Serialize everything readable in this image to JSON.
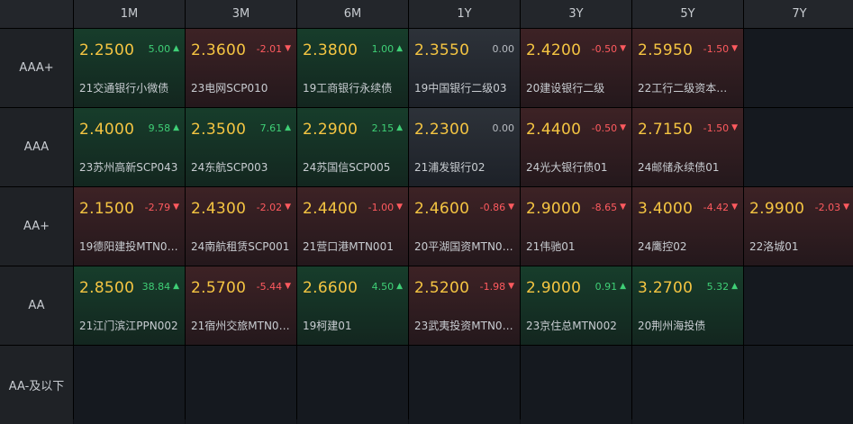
{
  "columns": [
    "1M",
    "3M",
    "6M",
    "1Y",
    "3Y",
    "5Y",
    "7Y"
  ],
  "rows": [
    {
      "label": "AAA+",
      "cells": [
        {
          "yield": "2.2500",
          "change": "5.00",
          "dir": "up",
          "name": "21交通银行小微债"
        },
        {
          "yield": "2.3600",
          "change": "-2.01",
          "dir": "down",
          "name": "23电网SCP010"
        },
        {
          "yield": "2.3800",
          "change": "1.00",
          "dir": "up",
          "name": "19工商银行永续债"
        },
        {
          "yield": "2.3550",
          "change": "0.00",
          "dir": "flat",
          "name": "19中国银行二级03"
        },
        {
          "yield": "2.4200",
          "change": "-0.50",
          "dir": "down",
          "name": "20建设银行二级"
        },
        {
          "yield": "2.5950",
          "change": "-1.50",
          "dir": "down",
          "name": "22工行二级资本债…"
        },
        null
      ]
    },
    {
      "label": "AAA",
      "cells": [
        {
          "yield": "2.4000",
          "change": "9.58",
          "dir": "up",
          "name": "23苏州高新SCP043"
        },
        {
          "yield": "2.3500",
          "change": "7.61",
          "dir": "up",
          "name": "24东航SCP003"
        },
        {
          "yield": "2.2900",
          "change": "2.15",
          "dir": "up",
          "name": "24苏国信SCP005"
        },
        {
          "yield": "2.2300",
          "change": "0.00",
          "dir": "flat",
          "name": "21浦发银行02"
        },
        {
          "yield": "2.4400",
          "change": "-0.50",
          "dir": "down",
          "name": "24光大银行债01"
        },
        {
          "yield": "2.7150",
          "change": "-1.50",
          "dir": "down",
          "name": "24邮储永续债01"
        },
        null
      ]
    },
    {
      "label": "AA+",
      "cells": [
        {
          "yield": "2.1500",
          "change": "-2.79",
          "dir": "down",
          "name": "19德阳建投MTN0…"
        },
        {
          "yield": "2.4300",
          "change": "-2.02",
          "dir": "down",
          "name": "24南航租赁SCP001"
        },
        {
          "yield": "2.4400",
          "change": "-1.00",
          "dir": "down",
          "name": "21营口港MTN001"
        },
        {
          "yield": "2.4600",
          "change": "-0.86",
          "dir": "down",
          "name": "20平湖国资MTN0…"
        },
        {
          "yield": "2.9000",
          "change": "-8.65",
          "dir": "down",
          "name": "21伟驰01"
        },
        {
          "yield": "3.4000",
          "change": "-4.42",
          "dir": "down",
          "name": "24鹰控02"
        },
        {
          "yield": "2.9900",
          "change": "-2.03",
          "dir": "down",
          "name": "22洛城01"
        }
      ]
    },
    {
      "label": "AA",
      "cells": [
        {
          "yield": "2.8500",
          "change": "38.84",
          "dir": "up",
          "name": "21江门滨江PPN002"
        },
        {
          "yield": "2.5700",
          "change": "-5.44",
          "dir": "down",
          "name": "21宿州交旅MTN0…"
        },
        {
          "yield": "2.6600",
          "change": "4.50",
          "dir": "up",
          "name": "19柯建01"
        },
        {
          "yield": "2.5200",
          "change": "-1.98",
          "dir": "down",
          "name": "23武夷投资MTN0…"
        },
        {
          "yield": "2.9000",
          "change": "0.91",
          "dir": "up",
          "name": "23京住总MTN002"
        },
        {
          "yield": "3.2700",
          "change": "5.32",
          "dir": "up",
          "name": "20荆州海投债"
        },
        null
      ]
    },
    {
      "label": "AA-及以下",
      "cells": [
        null,
        null,
        null,
        null,
        null,
        null,
        null
      ]
    }
  ],
  "icons": {
    "up": "triangle-up-icon",
    "down": "triangle-down-icon"
  },
  "colors": {
    "up": "#3fcf76",
    "down": "#ff5a5f",
    "yield": "#f5c542",
    "flat": "#b8bcc2"
  }
}
